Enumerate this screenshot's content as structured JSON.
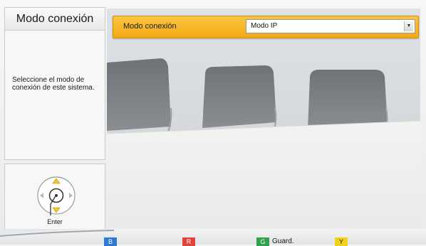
{
  "sidebar": {
    "title": "Modo conexión",
    "help_text": "Seleccione el modo de conexión de este sistema.",
    "nav": {
      "enter_label": "Enter"
    }
  },
  "main": {
    "setting": {
      "label": "Modo conexión",
      "value": "Modo IP"
    }
  },
  "bottom_bar": {
    "keys": [
      {
        "chip": "B",
        "label": "",
        "color": "#2f78d4"
      },
      {
        "chip": "R",
        "label": "",
        "color": "#e0443a"
      },
      {
        "chip": "G",
        "label": "Guard.",
        "color": "#2fa24f"
      },
      {
        "chip": "Y",
        "label": "",
        "color": "#f1d21a"
      }
    ]
  },
  "colors": {
    "accent": "#f4a913"
  }
}
